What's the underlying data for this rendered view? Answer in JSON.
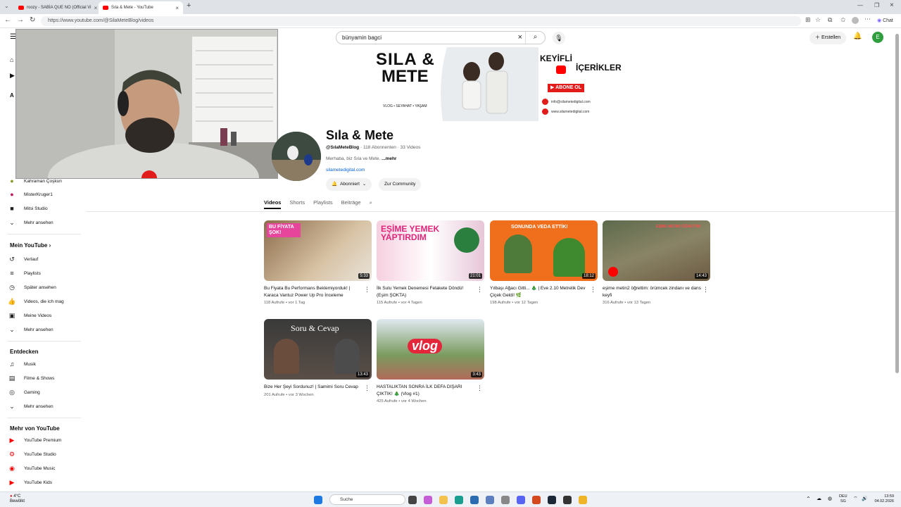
{
  "browser": {
    "tabs": [
      {
        "label": "roozy - SABİA QUE NO (Official Vi"
      },
      {
        "label": "Sıla & Mete - YouTube"
      }
    ],
    "url": "https://www.youtube.com/@SilaMeteBlog/videos",
    "chat_label": "Chat"
  },
  "header": {
    "search_value": "bünyamin bagci",
    "create_label": "Erstellen",
    "avatar_letter": "E"
  },
  "sidebar": {
    "subs": [
      {
        "label": "Kahraman Çoşkun"
      },
      {
        "label": "MisterKruger1"
      },
      {
        "label": "Mitsi Studio"
      },
      {
        "label": "Mehr ansehen"
      }
    ],
    "mein_title": "Mein YouTube",
    "mein_items": [
      {
        "label": "Verlauf"
      },
      {
        "label": "Playlists"
      },
      {
        "label": "Später ansehen"
      },
      {
        "label": "Videos, die ich mag"
      },
      {
        "label": "Meine Videos"
      },
      {
        "label": "Mehr ansehen"
      }
    ],
    "explore_title": "Entdecken",
    "explore_items": [
      {
        "label": "Musik"
      },
      {
        "label": "Filme & Shows"
      },
      {
        "label": "Gaming"
      },
      {
        "label": "Mehr ansehen"
      }
    ],
    "more_title": "Mehr von YouTube",
    "more_items": [
      {
        "label": "YouTube Premium"
      },
      {
        "label": "YouTube Studio"
      },
      {
        "label": "YouTube Music"
      },
      {
        "label": "YouTube Kids"
      }
    ]
  },
  "banner": {
    "name_line1": "SILA &",
    "name_line2": "METE",
    "tagline": "VLOG • SEYAHAT • YAŞAM",
    "keyifli": "KEYİFLİ",
    "icerikler": "İÇERİKLER",
    "subscribe": "ABONE OL",
    "email": "info@silametedigital.com",
    "web": "www.silametedigital.com"
  },
  "channel": {
    "name": "Sıla & Mete",
    "handle": "@SılaMeteBlog",
    "subs": "118 Abonnenten",
    "videos_count": "33 Videos",
    "description": "Merhaba, biz Sıla ve Mete.",
    "more": "...mehr",
    "link": "silametedigital.com",
    "subscribed_label": "Abonniert",
    "community_label": "Zur Community"
  },
  "tabs": [
    {
      "label": "Videos"
    },
    {
      "label": "Shorts"
    },
    {
      "label": "Playlists"
    },
    {
      "label": "Beiträge"
    }
  ],
  "videos": [
    {
      "title": "Bu Fiyata Bu Performans Beklemiyorduk! | Karaca Vantuz Power Up Pro İnceleme",
      "views": "118 Aufrufe",
      "age": "vor 1 Tag",
      "duration": "5:33",
      "thumb_text": "BU FİYATA ŞOK!"
    },
    {
      "title": "İlk Sulu Yemek Denemesi Felakete Döndü! (Eşim ŞOKTA)",
      "views": "115 Aufrufe",
      "age": "vor 4 Tagen",
      "duration": "21:01",
      "thumb_text": "EŞİME YEMEK YAPTIRDIM"
    },
    {
      "title": "Yılbaşı Ağacı Gitti... 🎄 | Eve 2.10 Metrelik Dev Çiçek Geldi! 🌿",
      "views": "198 Aufrufe",
      "age": "vor 12 Tagen",
      "duration": "18:12",
      "thumb_text": "SONUNDA VEDA ETTİK!"
    },
    {
      "title": "eşime metin2 öğrettim: örümcek zindanı ve dans keyfi",
      "views": "316 Aufrufe",
      "age": "vor 13 Tagen",
      "duration": "14:43",
      "thumb_text": "EŞİME METİN2 ÖĞRETTİM"
    },
    {
      "title": "Bize Her Şeyi Sordunuz! | Samimi Soru Cevap",
      "views": "201 Aufrufe",
      "age": "vor 3 Wochen",
      "duration": "13:43",
      "thumb_text": "Soru & Cevap"
    },
    {
      "title": "HASTALIKTAN SONRA İLK DEFA DIŞARI ÇIKTIK! 🎄 (Vlog #1)",
      "views": "425 Aufrufe",
      "age": "vor 4 Wochen",
      "duration": "3:43",
      "thumb_text": "vlog"
    }
  ],
  "taskbar": {
    "weather_temp": "4°C",
    "weather_desc": "Bewölkt",
    "search_placeholder": "Suche",
    "lang1": "DEU",
    "lang2": "SG",
    "time": "13:59",
    "date": "04.02.2026"
  },
  "colors": {
    "accent": "#ff0000",
    "link": "#065fd4",
    "avatar": "#2e9e3e"
  }
}
